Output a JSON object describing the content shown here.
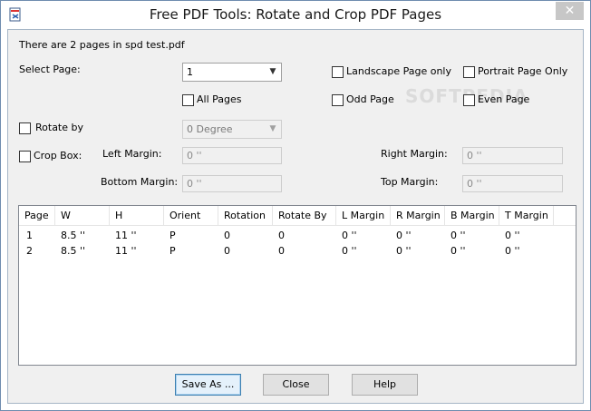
{
  "window": {
    "title": "Free PDF Tools: Rotate and Crop PDF Pages",
    "close_label": "✕"
  },
  "info": {
    "page_count_text": "There are 2 pages in spd test.pdf"
  },
  "select_page": {
    "label": "Select Page:",
    "value": "1"
  },
  "options": {
    "landscape_only": "Landscape Page only",
    "portrait_only": "Portrait Page Only",
    "all_pages": "All Pages",
    "odd_page": "Odd Page",
    "even_page": "Even Page"
  },
  "rotate": {
    "label": "Rotate by",
    "value": "0 Degree"
  },
  "crop": {
    "label": "Crop Box:",
    "left_margin_label": "Left Margin:",
    "left_margin_value": "0 ''",
    "right_margin_label": "Right Margin:",
    "right_margin_value": "0 ''",
    "bottom_margin_label": "Bottom Margin:",
    "bottom_margin_value": "0 ''",
    "top_margin_label": "Top Margin:",
    "top_margin_value": "0 ''"
  },
  "table": {
    "columns": [
      "Page",
      "W",
      "H",
      "Orient",
      "Rotation",
      "Rotate By",
      "L Margin",
      "R Margin",
      "B Margin",
      "T Margin"
    ],
    "rows": [
      [
        "1",
        "8.5 ''",
        "11 ''",
        "P",
        "0",
        "0",
        "0 ''",
        "0 ''",
        "0 ''",
        "0 ''"
      ],
      [
        "2",
        "8.5 ''",
        "11 ''",
        "P",
        "0",
        "0",
        "0 ''",
        "0 ''",
        "0 ''",
        "0 ''"
      ]
    ]
  },
  "buttons": {
    "save_as": "Save As ...",
    "close": "Close",
    "help": "Help"
  },
  "watermark": "SOFTPEDIA"
}
